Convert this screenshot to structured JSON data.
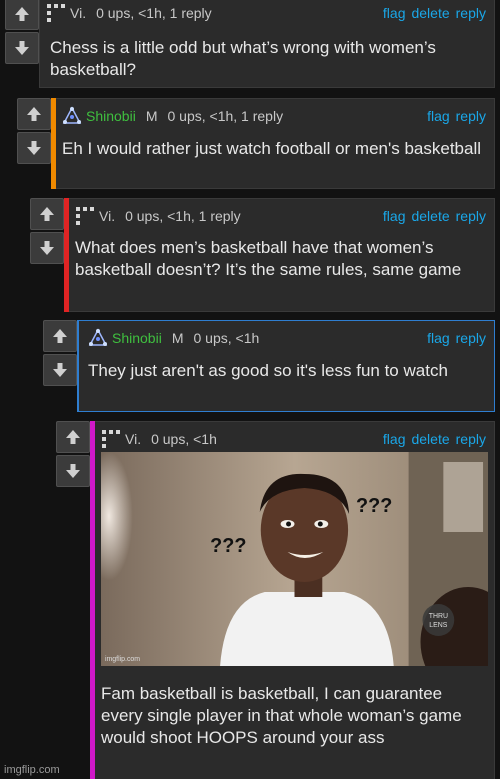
{
  "colors": {
    "link": "#1aa7e8",
    "mod_green": "#3fbf3f",
    "bar_orange": "#f08a00",
    "bar_red": "#e02424",
    "bar_magenta": "#d018c8",
    "bar_blue": "#2f7ed0"
  },
  "comments": [
    {
      "user": "Vi.",
      "meta": "0 ups, <1h, 1 reply",
      "actions": [
        "flag",
        "delete",
        "reply"
      ],
      "text": "Chess is a little odd but what’s wrong with women’s basketball?"
    },
    {
      "user": "Shinobii",
      "mod": "M",
      "meta": "0 ups, <1h, 1 reply",
      "actions": [
        "flag",
        "reply"
      ],
      "text": "Eh I would rather just watch football or men's basketball"
    },
    {
      "user": "Vi.",
      "meta": "0 ups, <1h, 1 reply",
      "actions": [
        "flag",
        "delete",
        "reply"
      ],
      "text": "What does men’s basketball have that women’s basketball doesn’t? It’s the same rules, same game"
    },
    {
      "user": "Shinobii",
      "mod": "M",
      "meta": "0 ups, <1h",
      "actions": [
        "flag",
        "reply"
      ],
      "text": "They just aren't as good so it's less fun to watch"
    },
    {
      "user": "Vi.",
      "meta": "0 ups, <1h",
      "actions": [
        "flag",
        "delete",
        "reply"
      ],
      "text": "Fam basketball is basketball, I can guarantee every single player in that whole woman’s game would shoot HOOPS around your ass",
      "meme": {
        "q1": "???",
        "q2": "???",
        "badge_top": "THRU",
        "badge_bottom": "LENS",
        "credit": "imgflip.com"
      }
    }
  ],
  "watermark": "imgflip.com",
  "icons": {
    "upvote": "arrow-up-icon",
    "downvote": "arrow-down-icon",
    "avatar_vi": "pixel-grid-avatar",
    "avatar_shinobii": "triangle-stars-avatar"
  }
}
